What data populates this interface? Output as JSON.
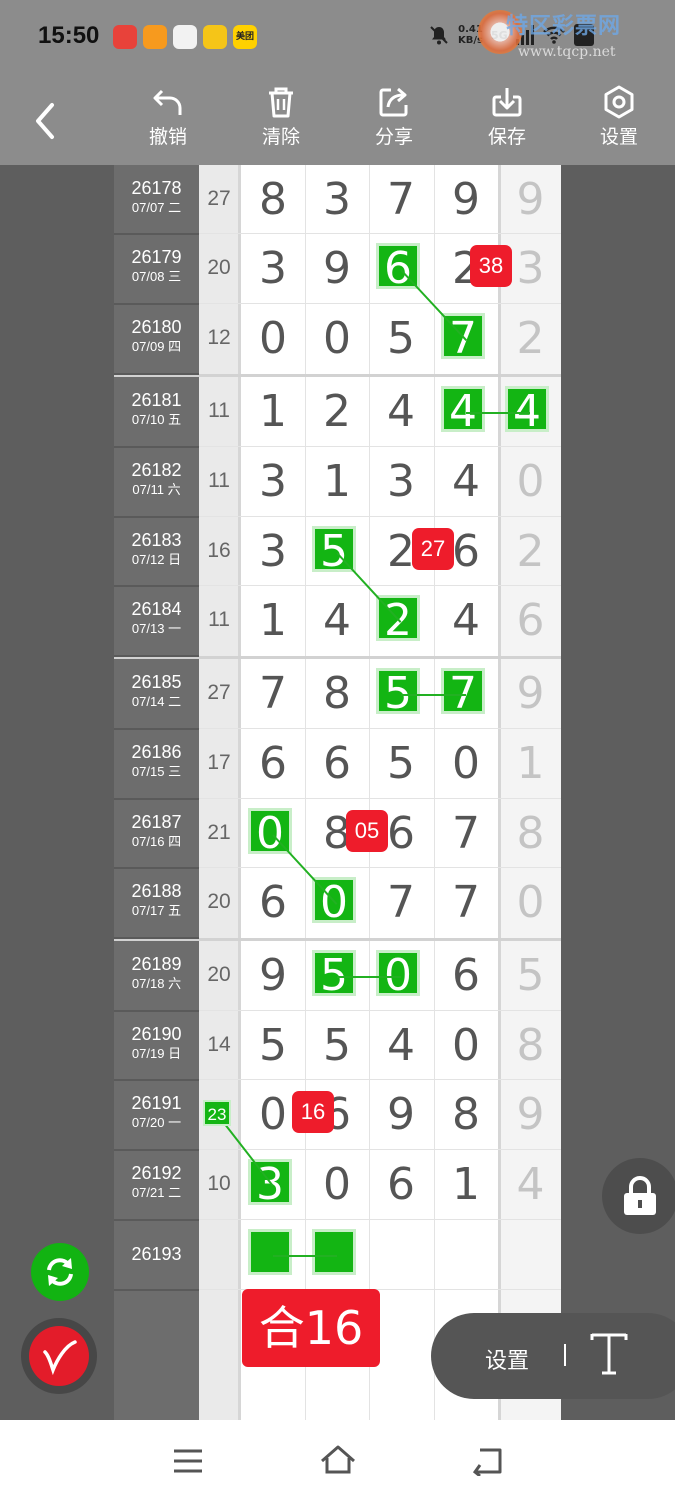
{
  "status_bar": {
    "time": "15:50",
    "app_icons": [
      {
        "icon": "app-icon-red",
        "text": "",
        "color": "#e8423a"
      },
      {
        "icon": "app-icon-orange",
        "text": "",
        "color": "#f79a1e"
      },
      {
        "icon": "app-icon-avatar",
        "text": "",
        "color": "#f2f2f2"
      },
      {
        "icon": "app-icon-yellow",
        "text": "",
        "color": "#f5c518"
      },
      {
        "icon": "app-icon-meituan",
        "text": "美团",
        "color": "#ffd100"
      }
    ],
    "net_speed": "0.41",
    "net_unit": "KB/s",
    "network": "5G",
    "watermark_text": "特区彩票网",
    "watermark_url": "www.tqcp.net"
  },
  "toolbar": {
    "undo_label": "撤销",
    "clear_label": "清除",
    "share_label": "分享",
    "save_label": "保存",
    "settings_label": "设置"
  },
  "rows": [
    {
      "issue": "26178",
      "date": "07/07 二",
      "sum": "27",
      "digits": [
        "8",
        "3",
        "7",
        "9"
      ],
      "extra": "9"
    },
    {
      "issue": "26179",
      "date": "07/08 三",
      "sum": "20",
      "digits": [
        "3",
        "9",
        "6",
        "2"
      ],
      "extra": "3"
    },
    {
      "issue": "26180",
      "date": "07/09 四",
      "sum": "12",
      "digits": [
        "0",
        "0",
        "5",
        "7"
      ],
      "extra": "2"
    },
    {
      "issue": "26181",
      "date": "07/10 五",
      "sum": "11",
      "digits": [
        "1",
        "2",
        "4",
        "4"
      ],
      "extra": "4"
    },
    {
      "issue": "26182",
      "date": "07/11 六",
      "sum": "11",
      "digits": [
        "3",
        "1",
        "3",
        "4"
      ],
      "extra": "0"
    },
    {
      "issue": "26183",
      "date": "07/12 日",
      "sum": "16",
      "digits": [
        "3",
        "5",
        "2",
        "6"
      ],
      "extra": "2"
    },
    {
      "issue": "26184",
      "date": "07/13 一",
      "sum": "11",
      "digits": [
        "1",
        "4",
        "2",
        "4"
      ],
      "extra": "6"
    },
    {
      "issue": "26185",
      "date": "07/14 二",
      "sum": "27",
      "digits": [
        "7",
        "8",
        "5",
        "7"
      ],
      "extra": "9"
    },
    {
      "issue": "26186",
      "date": "07/15 三",
      "sum": "17",
      "digits": [
        "6",
        "6",
        "5",
        "0"
      ],
      "extra": "1"
    },
    {
      "issue": "26187",
      "date": "07/16 四",
      "sum": "21",
      "digits": [
        "0",
        "8",
        "6",
        "7"
      ],
      "extra": "8"
    },
    {
      "issue": "26188",
      "date": "07/17 五",
      "sum": "20",
      "digits": [
        "6",
        "0",
        "7",
        "7"
      ],
      "extra": "0"
    },
    {
      "issue": "26189",
      "date": "07/18 六",
      "sum": "20",
      "digits": [
        "9",
        "5",
        "0",
        "6"
      ],
      "extra": "5"
    },
    {
      "issue": "26190",
      "date": "07/19 日",
      "sum": "14",
      "digits": [
        "5",
        "5",
        "4",
        "0"
      ],
      "extra": "8"
    },
    {
      "issue": "26191",
      "date": "07/20 一",
      "sum": "",
      "digits": [
        "0",
        "6",
        "9",
        "8"
      ],
      "extra": "9"
    },
    {
      "issue": "26192",
      "date": "07/21 二",
      "sum": "10",
      "digits": [
        "3",
        "0",
        "6",
        "1"
      ],
      "extra": "4"
    },
    {
      "issue": "26193",
      "date": "",
      "sum": "",
      "digits": [
        "",
        "",
        "",
        ""
      ],
      "extra": ""
    }
  ],
  "highlights": [
    {
      "row": 1,
      "col": 2
    },
    {
      "row": 2,
      "col": 3
    },
    {
      "row": 3,
      "col": 3
    },
    {
      "row": 3,
      "col": 4
    },
    {
      "row": 5,
      "col": 1
    },
    {
      "row": 6,
      "col": 2
    },
    {
      "row": 7,
      "col": 2
    },
    {
      "row": 7,
      "col": 3
    },
    {
      "row": 9,
      "col": 0
    },
    {
      "row": 10,
      "col": 1
    },
    {
      "row": 11,
      "col": 1
    },
    {
      "row": 11,
      "col": 2
    },
    {
      "row": 14,
      "col": 0
    },
    {
      "row": 15,
      "col": 0
    },
    {
      "row": 15,
      "col": 1
    }
  ],
  "sum_marker": {
    "row": 13,
    "value": "23"
  },
  "red_tags": [
    {
      "row": 1,
      "value": "38"
    },
    {
      "row": 5,
      "value": "27"
    },
    {
      "row": 9,
      "value": "05"
    },
    {
      "row": 13,
      "value": "16"
    }
  ],
  "total_label": "合16",
  "settings_pill": {
    "label": "设置",
    "icon": "text-T-icon"
  },
  "colors": {
    "highlight": "#13b513",
    "tag": "#ee1c2b",
    "header": "#8c8c8c"
  }
}
